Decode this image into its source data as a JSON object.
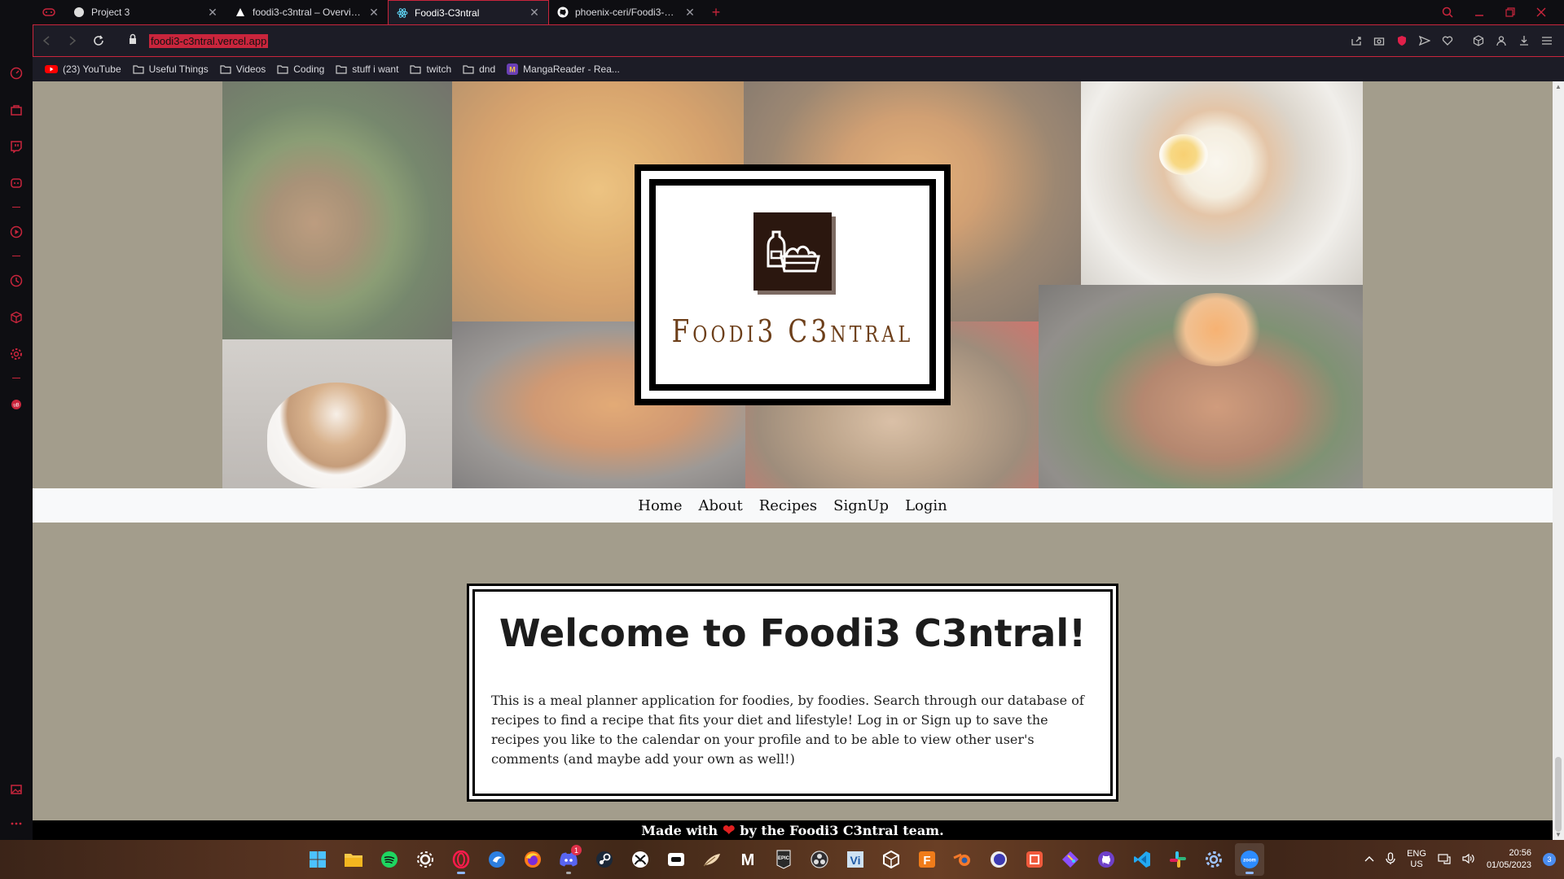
{
  "browser": {
    "tabs": [
      {
        "title": "Project 3",
        "icon": "pinwheel-icon",
        "active": false
      },
      {
        "title": "foodi3-c3ntral – Overview",
        "icon": "vercel-triangle-icon",
        "active": false
      },
      {
        "title": "Foodi3-C3ntral",
        "icon": "react-icon",
        "active": true
      },
      {
        "title": "phoenix-ceri/Foodi3-C3ntral",
        "icon": "github-icon",
        "active": false
      }
    ],
    "url": "foodi3-c3ntral.vercel.app",
    "bookmarks": [
      {
        "label": "(23) YouTube",
        "icon": "youtube-icon"
      },
      {
        "label": "Useful Things",
        "icon": "folder-icon"
      },
      {
        "label": "Videos",
        "icon": "folder-icon"
      },
      {
        "label": "Coding",
        "icon": "folder-icon"
      },
      {
        "label": "stuff i want",
        "icon": "folder-icon"
      },
      {
        "label": "twitch",
        "icon": "folder-icon"
      },
      {
        "label": "dnd",
        "icon": "folder-icon"
      },
      {
        "label": "MangaReader - Rea...",
        "icon": "mangareader-icon"
      }
    ],
    "accent": "#c9253c"
  },
  "site": {
    "logo_text": "Foodi3 C3ntral",
    "nav": [
      "Home",
      "About",
      "Recipes",
      "SignUp",
      "Login"
    ],
    "welcome_title": "Welcome to Foodi3 C3ntral!",
    "welcome_text": "This is a meal planner application for foodies, by foodies. Search through our database of recipes to find a recipe that fits your diet and lifestyle! Log in or Sign up to save the recipes you like to the calendar on your profile and to be able to view other user's comments (and maybe add your own as well!)",
    "footer_before": "Made with",
    "footer_after": "by the Foodi3 C3ntral team.",
    "background": "#a39d8c"
  },
  "taskbar": {
    "apps": [
      "windows-start-icon",
      "file-explorer-icon",
      "spotify-icon",
      "steelseries-icon",
      "opera-gx-icon",
      "bitwarden-icon",
      "firefox-icon",
      "discord-icon",
      "steam-icon",
      "xbox-icon",
      "app-icon",
      "feather-icon",
      "m-app-icon",
      "epic-games-icon",
      "obs-icon",
      "vi-app-icon",
      "unity-icon",
      "f-app-icon",
      "blender-icon",
      "godot-icon",
      "app-icon",
      "git-icon",
      "github-desktop-icon",
      "vscode-icon",
      "slack-icon",
      "settings-icon",
      "zoom-icon"
    ],
    "discord_badge": "1",
    "lang_top": "ENG",
    "lang_bottom": "US",
    "time": "20:56",
    "date": "01/05/2023",
    "notifications": "3"
  }
}
